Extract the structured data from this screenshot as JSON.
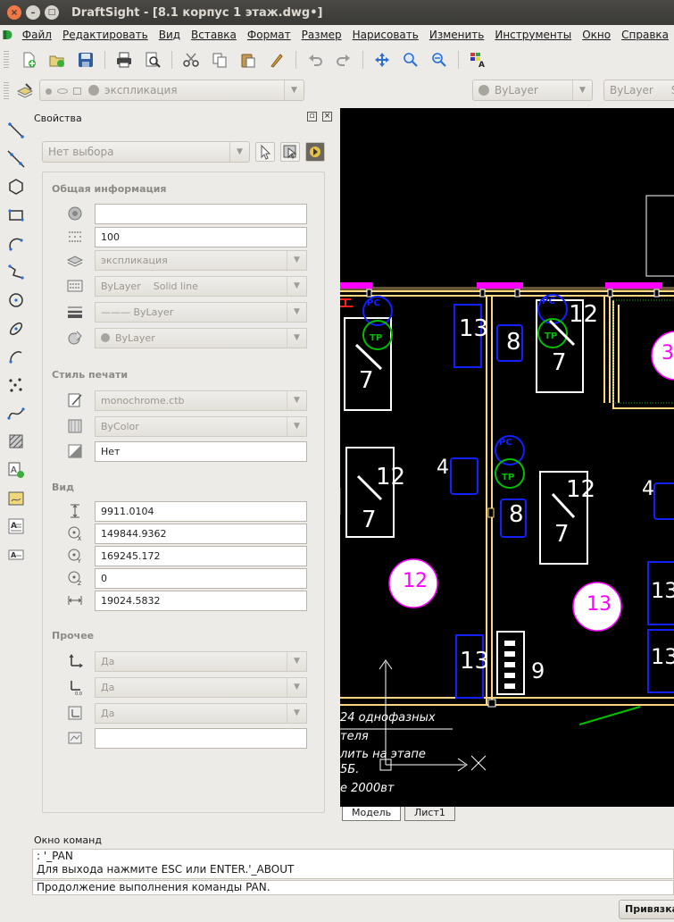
{
  "window": {
    "title": "DraftSight - [8.1 корпус 1 этаж.dwg•]",
    "close_glyph": "×",
    "minimize_glyph": "–",
    "maximize_glyph": "□"
  },
  "menu": [
    "Файл",
    "Редактировать",
    "Вид",
    "Вставка",
    "Формат",
    "Размер",
    "Нарисовать",
    "Изменить",
    "Инструменты",
    "Окно",
    "Справка"
  ],
  "toolbar": {
    "icons": [
      "new-file-icon",
      "open-file-icon",
      "save-icon",
      "print-icon",
      "print-preview-icon",
      "cut-icon",
      "copy-icon",
      "paste-icon",
      "match-properties-icon",
      "undo-icon",
      "redo-icon",
      "pan-icon",
      "zoom-window-icon",
      "zoom-previous-icon",
      "properties-palette-icon"
    ]
  },
  "layerbar": {
    "layer_value": "экспликация",
    "color_value": "ByLayer",
    "linetype_value": "ByLayer",
    "linetype_extra": "Sc"
  },
  "properties": {
    "title": "Свойства",
    "selection": "Нет выбора",
    "sections": {
      "general": "Общая информация",
      "print_style": "Стиль печати",
      "view": "Вид",
      "other": "Прочее"
    },
    "general": {
      "color": "",
      "scale": "100",
      "layer": "экспликация",
      "linetype_a": "ByLayer",
      "linetype_b": "Solid line",
      "lineweight": "——— ByLayer",
      "plot_color": "ByLayer"
    },
    "print_style": {
      "style_table": "monochrome.ctb",
      "plot_style": "ByColor",
      "attached": "Нет"
    },
    "view": {
      "height": "9911.0104",
      "center_x": "149844.9362",
      "center_y": "169245.172",
      "center_z": "0",
      "width": "19024.5832"
    },
    "other": {
      "ucs_icon_on": "Да",
      "ucs_icon_at_origin": "Да",
      "ucs_per_viewport": "Да",
      "ucs_name": ""
    }
  },
  "canvas": {
    "labels": [
      "13",
      "8",
      "12",
      "7",
      "7",
      "3",
      "12",
      "4",
      "7",
      "8",
      "12",
      "7",
      "4",
      "12",
      "13",
      "13",
      "13",
      "9",
      "13"
    ],
    "marker_texts": [
      "PC",
      "TP",
      "PC",
      "TP",
      "PC",
      "TP"
    ],
    "notes": [
      "24 однофазных",
      "теля",
      "лить на этапе",
      "5Б.",
      "е 2000вт"
    ],
    "colors": {
      "background": "#000000",
      "wall": "#ffd580",
      "magenta": "#ff00ff",
      "blue": "#1020ff",
      "green": "#00c000",
      "white": "#ffffff"
    }
  },
  "tabs": [
    "Модель",
    "Лист1"
  ],
  "command": {
    "title": "Окно команд",
    "history": [
      ": '_PAN",
      "Для выхода нажмите ESC или ENTER.'_ABOUT"
    ],
    "current": "Продолжение выполнения команды PAN."
  },
  "status": {
    "snap_button": "Привязка"
  }
}
